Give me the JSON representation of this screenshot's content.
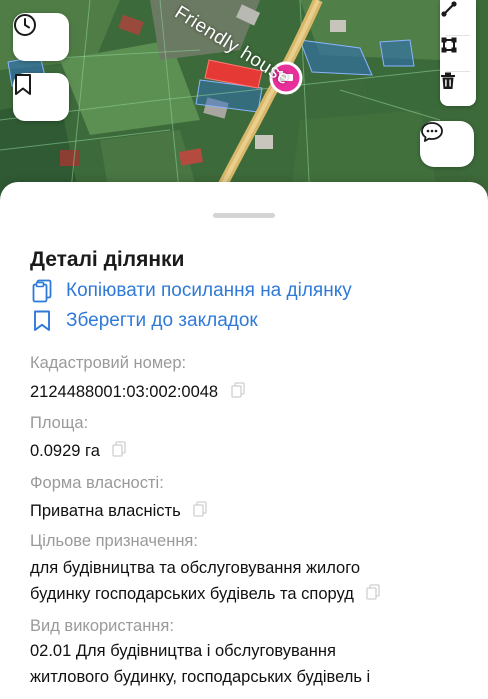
{
  "map": {
    "place_label": "Friendly house",
    "colors": {
      "parcel_fill": "#2f6fc0",
      "parcel_selected": "#e53935",
      "poi_pin": "#e8309a",
      "road": "#d9b86a"
    }
  },
  "map_controls": {
    "history_icon": "clock-icon",
    "bookmarks_icon": "bookmark-icon",
    "measure_icon": "ruler-line-icon",
    "area_icon": "polygon-square-icon",
    "delete_icon": "trash-icon",
    "chat_icon": "chat-bubble-icon"
  },
  "details": {
    "title": "Деталі ділянки",
    "copy_link_label": "Копіювати посилання на ділянку",
    "save_bookmark_label": "Зберегти до закладок",
    "fields": {
      "cadastral_number": {
        "label": "Кадастровий номер:",
        "value": "2124488001:03:002:0048"
      },
      "area": {
        "label": "Площа:",
        "value": "0.0929 га"
      },
      "ownership": {
        "label": "Форма власності:",
        "value": "Приватна власність"
      },
      "purpose": {
        "label": "Цільове призначення:",
        "value_line1": "для будівництва та обслуговування жилого",
        "value_line2": "будинку господарських будівель та споруд"
      },
      "usage": {
        "label": "Вид використання:",
        "value_line1": "02.01 Для будівництва і обслуговування",
        "value_line2": "житлового будинку, господарських будівель і"
      }
    }
  },
  "colors": {
    "accent": "#2f7ad8",
    "label_gray": "#9a9a9a",
    "text": "#111111"
  }
}
